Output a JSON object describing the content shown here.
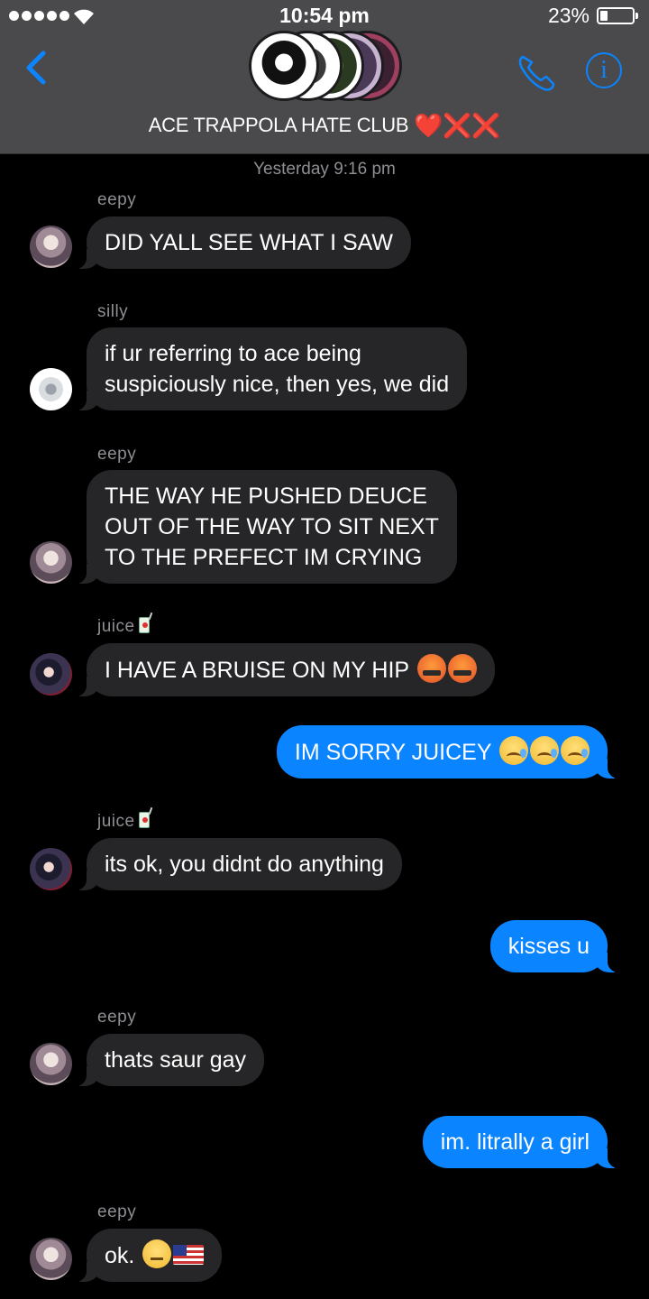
{
  "status_bar": {
    "time": "10:54 pm",
    "battery_percent": "23%",
    "battery_level": 0.23,
    "signal_bars": 5
  },
  "header": {
    "title": "ACE TRAPPOLA HATE CLUB",
    "title_emoji": "❤️❌❌",
    "icons": [
      "back-chevron-icon",
      "phone-icon",
      "info-icon"
    ],
    "accent_color": "#0a84ff"
  },
  "chat": {
    "timestamp": "Yesterday 9:16 pm",
    "messages": [
      {
        "sender": "eepy",
        "text": "DID YALL SEE WHAT I SAW"
      },
      {
        "sender": "silly",
        "text_lines": [
          "if ur referring to ace being",
          "suspiciously nice, then yes, we did"
        ]
      },
      {
        "sender": "eepy",
        "text_lines": [
          "THE WAY HE PUSHED DEUCE",
          "OUT OF THE WAY TO SIT NEXT",
          "TO THE PREFECT IM CRYING"
        ]
      },
      {
        "sender": "juice",
        "text": "I HAVE A BRUISE ON MY HIP",
        "emoji": "🤬🤬"
      },
      {
        "sender": "me",
        "text": "IM SORRY JUICEY",
        "emoji": "😢😢😢"
      },
      {
        "sender": "juice",
        "text": "its ok, you didnt do anything"
      },
      {
        "sender": "me",
        "text": "kisses u"
      },
      {
        "sender": "eepy",
        "text": "thats saur gay"
      },
      {
        "sender": "me",
        "text": "im. litrally a girl"
      },
      {
        "sender": "eepy",
        "text": "ok.",
        "emoji": "😐🇺🇸"
      }
    ]
  },
  "colors": {
    "incoming_bubble": "#262628",
    "outgoing_bubble": "#0a84ff",
    "header_bg": "#4a4a4c"
  }
}
